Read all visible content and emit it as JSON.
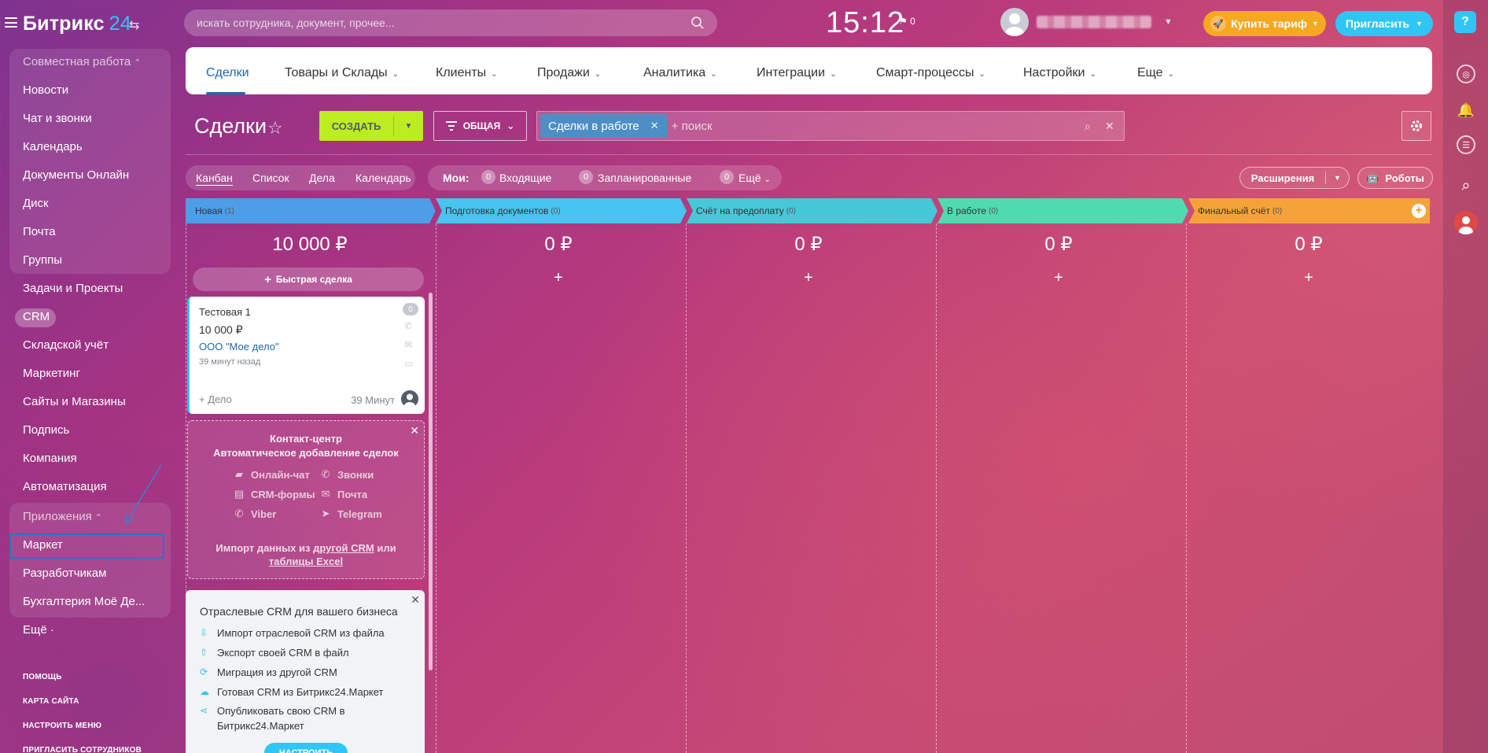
{
  "header": {
    "logo_name": "Битрикс",
    "logo_num": "24",
    "search_placeholder": "искать сотрудника, документ, прочее...",
    "clock": "15:12",
    "flag_count": "0",
    "buy_label": "Купить тариф",
    "invite_label": "Пригласить"
  },
  "sidebar": {
    "group_collab": "Совместная работа",
    "items_collab": [
      "Новости",
      "Чат и звонки",
      "Календарь",
      "Документы Онлайн",
      "Диск",
      "Почта",
      "Группы"
    ],
    "items_main": [
      "Задачи и Проекты",
      "CRM",
      "Складской учёт",
      "Маркетинг",
      "Сайты и Магазины",
      "Подпись",
      "Компания",
      "Автоматизация"
    ],
    "group_apps": "Приложения",
    "items_apps": [
      "Маркет",
      "Разработчикам",
      "Бухгалтерия Моё Де..."
    ],
    "more": "Ещё ·",
    "bottom_links": [
      "ПОМОЩЬ",
      "КАРТА САЙТА",
      "НАСТРОИТЬ МЕНЮ",
      "ПРИГЛАСИТЬ СОТРУДНИКОВ"
    ]
  },
  "tabs": [
    "Сделки",
    "Товары и Склады",
    "Клиенты",
    "Продажи",
    "Аналитика",
    "Интеграции",
    "Смарт-процессы",
    "Настройки",
    "Еще"
  ],
  "toolbar": {
    "title": "Сделки",
    "create_label": "СОЗДАТЬ",
    "general_label": "ОБЩАЯ",
    "filter_chip": "Сделки в работе",
    "filter_placeholder": "+ поиск"
  },
  "views": [
    "Канбан",
    "Список",
    "Дела",
    "Календарь"
  ],
  "mine": {
    "label": "Мои:",
    "items": [
      {
        "count": "0",
        "label": "Входящие"
      },
      {
        "count": "0",
        "label": "Запланированные"
      },
      {
        "count": "0",
        "label": "Ещё"
      }
    ]
  },
  "extensions_label": "Расширения",
  "robots_label": "Роботы",
  "colors": {
    "stage_new": "#4d9ee8",
    "stage_docs": "#47c4f0",
    "stage_invoice": "#46c8d8",
    "stage_work": "#4fdbae",
    "stage_final": "#f5a339"
  },
  "stages": [
    {
      "name": "Новая",
      "count": "(1)",
      "sum": "10 000 ₽"
    },
    {
      "name": "Подготовка документов",
      "count": "(0)",
      "sum": "0 ₽"
    },
    {
      "name": "Счёт на предоплату",
      "count": "(0)",
      "sum": "0 ₽"
    },
    {
      "name": "В работе",
      "count": "(0)",
      "sum": "0 ₽"
    },
    {
      "name": "Финальный счёт",
      "count": "(0)",
      "sum": "0 ₽"
    }
  ],
  "quick_deal_label": "Быстрая сделка",
  "deal": {
    "title": "Тестовая 1",
    "badge": "0",
    "sum": "10 000 ₽",
    "company": "ООО \"Мое дело\"",
    "time": "39 минут назад",
    "add_activity": "+ Дело",
    "minutes": "39 Минут"
  },
  "contact_center": {
    "title": "Контакт-центр",
    "subtitle": "Автоматическое добавление сделок",
    "items": [
      "Онлайн-чат",
      "Звонки",
      "CRM-формы",
      "Почта",
      "Viber",
      "Telegram"
    ],
    "import_prefix": "Импорт данных из",
    "import_link1": "другой CRM",
    "import_mid": "или",
    "import_link2": "таблицы Excel"
  },
  "industry_crm": {
    "title": "Отраслевые CRM для вашего бизнеса",
    "items": [
      "Импорт отраслевой CRM из файла",
      "Экспорт своей CRM в файл",
      "Миграция из другой CRM",
      "Готовая CRM из Битрикс24.Маркет",
      "Опубликовать свою CRM в",
      "Битрикс24.Маркет"
    ],
    "button": "НАСТРОИТЬ"
  }
}
